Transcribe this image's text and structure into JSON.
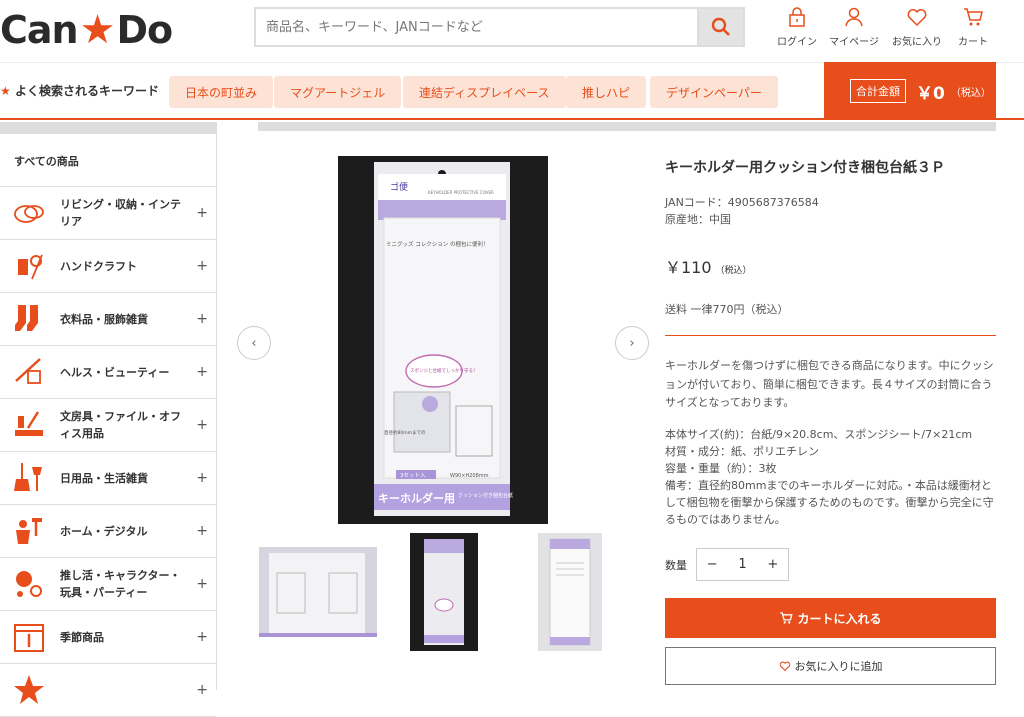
{
  "header": {
    "logo_left": "Can",
    "logo_star": "★",
    "logo_right": "Do",
    "search_placeholder": "商品名、キーワード、JANコードなど",
    "icons": [
      {
        "label": "ログイン",
        "icon": "lock-icon"
      },
      {
        "label": "マイページ",
        "icon": "user-icon"
      },
      {
        "label": "お気に入り",
        "icon": "heart-icon"
      },
      {
        "label": "カート",
        "icon": "cart-icon"
      }
    ]
  },
  "keywords": {
    "title": "よく検索されるキーワード",
    "star": "★",
    "items": [
      "日本の町並み",
      "マグアートジェル",
      "連結ディスプレイベース",
      "推しハピ",
      "デザインペーパー"
    ]
  },
  "cart_total": {
    "label": "合計金額",
    "amount": "￥0",
    "tax": "（税込）"
  },
  "sidebar": {
    "all_label": "すべての商品",
    "categories": [
      {
        "label": "リビング・収納・インテリア",
        "icon": "living-icon"
      },
      {
        "label": "ハンドクラフト",
        "icon": "handcraft-icon"
      },
      {
        "label": "衣料品・服飾雑貨",
        "icon": "socks-icon"
      },
      {
        "label": "ヘルス・ビューティー",
        "icon": "beauty-icon"
      },
      {
        "label": "文房具・ファイル・オフィス用品",
        "icon": "stationery-icon"
      },
      {
        "label": "日用品・生活雑貨",
        "icon": "broom-icon"
      },
      {
        "label": "ホーム・デジタル",
        "icon": "tools-icon"
      },
      {
        "label": "推し活・キャラクター・玩具・パーティー",
        "icon": "party-icon"
      },
      {
        "label": "季節商品",
        "icon": "calendar-icon"
      },
      {
        "label": "",
        "icon": "star-icon"
      }
    ],
    "plus": "+"
  },
  "product": {
    "title": "キーホルダー用クッション付き梱包台紙３Ｐ",
    "jan": "JANコード：4905687376584",
    "origin": "原産地：中国",
    "price": "￥110",
    "price_tax": "（税込）",
    "shipping": "送料 一律770円（税込）",
    "description": "キーホルダーを傷つけずに梱包できる商品になります。中にクッションが付いており、簡単に梱包できます。長４サイズの封筒に合うサイズとなっております。",
    "specs": [
      "本体サイズ(約)：台紙/9×20.8cm、スポンジシート/7×21cm",
      "材質・成分：紙、ポリエチレン",
      "容量・重量（約）：3枚",
      "備考：直径約80mmまでのキーホルダーに対応。・本品は緩衝材として梱包物を衝撃から保護するためのものです。衝撃から完全に守るものではありません。"
    ],
    "package_text": {
      "brand": "ゴ便",
      "subtitle": "KEYHOLDER PROTECTIVE COVER",
      "promo": "ミニグッズ コレクション の梱包に便利！",
      "callout": "スポンジと台紙でしっかり守る！",
      "count": "3セット入",
      "size": "W90×H208mm",
      "name": "キーホルダー用",
      "sub": "クッション付き梱包台紙",
      "max": "直径約80mmまでの"
    },
    "qty_label": "数量",
    "qty": "1",
    "qty_minus": "−",
    "qty_plus": "+",
    "cart_button": "カートに入れる",
    "fav_button": "お気に入りに追加",
    "prev": "‹",
    "next": "›"
  },
  "colors": {
    "accent": "#e84e1b",
    "accent_light": "#fde3d6"
  }
}
